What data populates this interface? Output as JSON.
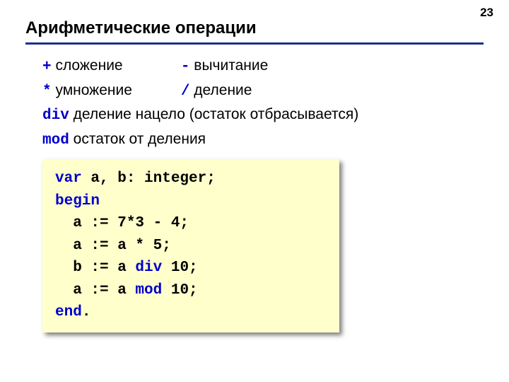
{
  "page_number": "23",
  "title": "Арифметические операции",
  "ops": {
    "plus_sym": "+",
    "plus_desc": " сложение",
    "minus_sym": "-",
    "minus_desc": " вычитание",
    "mul_sym": "*",
    "mul_desc": " умножение",
    "div_sym": "/",
    "div_desc": " деление",
    "intdiv_sym": "div",
    "intdiv_desc": " деление нацело (остаток отбрасывается)",
    "mod_sym": "mod",
    "mod_desc": " остаток от деления"
  },
  "code": {
    "l1a": "var",
    "l1b": " a, b: integer;",
    "l2": "begin",
    "l3": "  a := 7*3 - 4;",
    "l4": "  a := a * 5;",
    "l5a": "  b := a ",
    "l5b": "div",
    "l5c": " 10;",
    "l6a": "  a := a ",
    "l6b": "mod",
    "l6c": " 10;",
    "l7a": "end",
    "l7b": "."
  }
}
